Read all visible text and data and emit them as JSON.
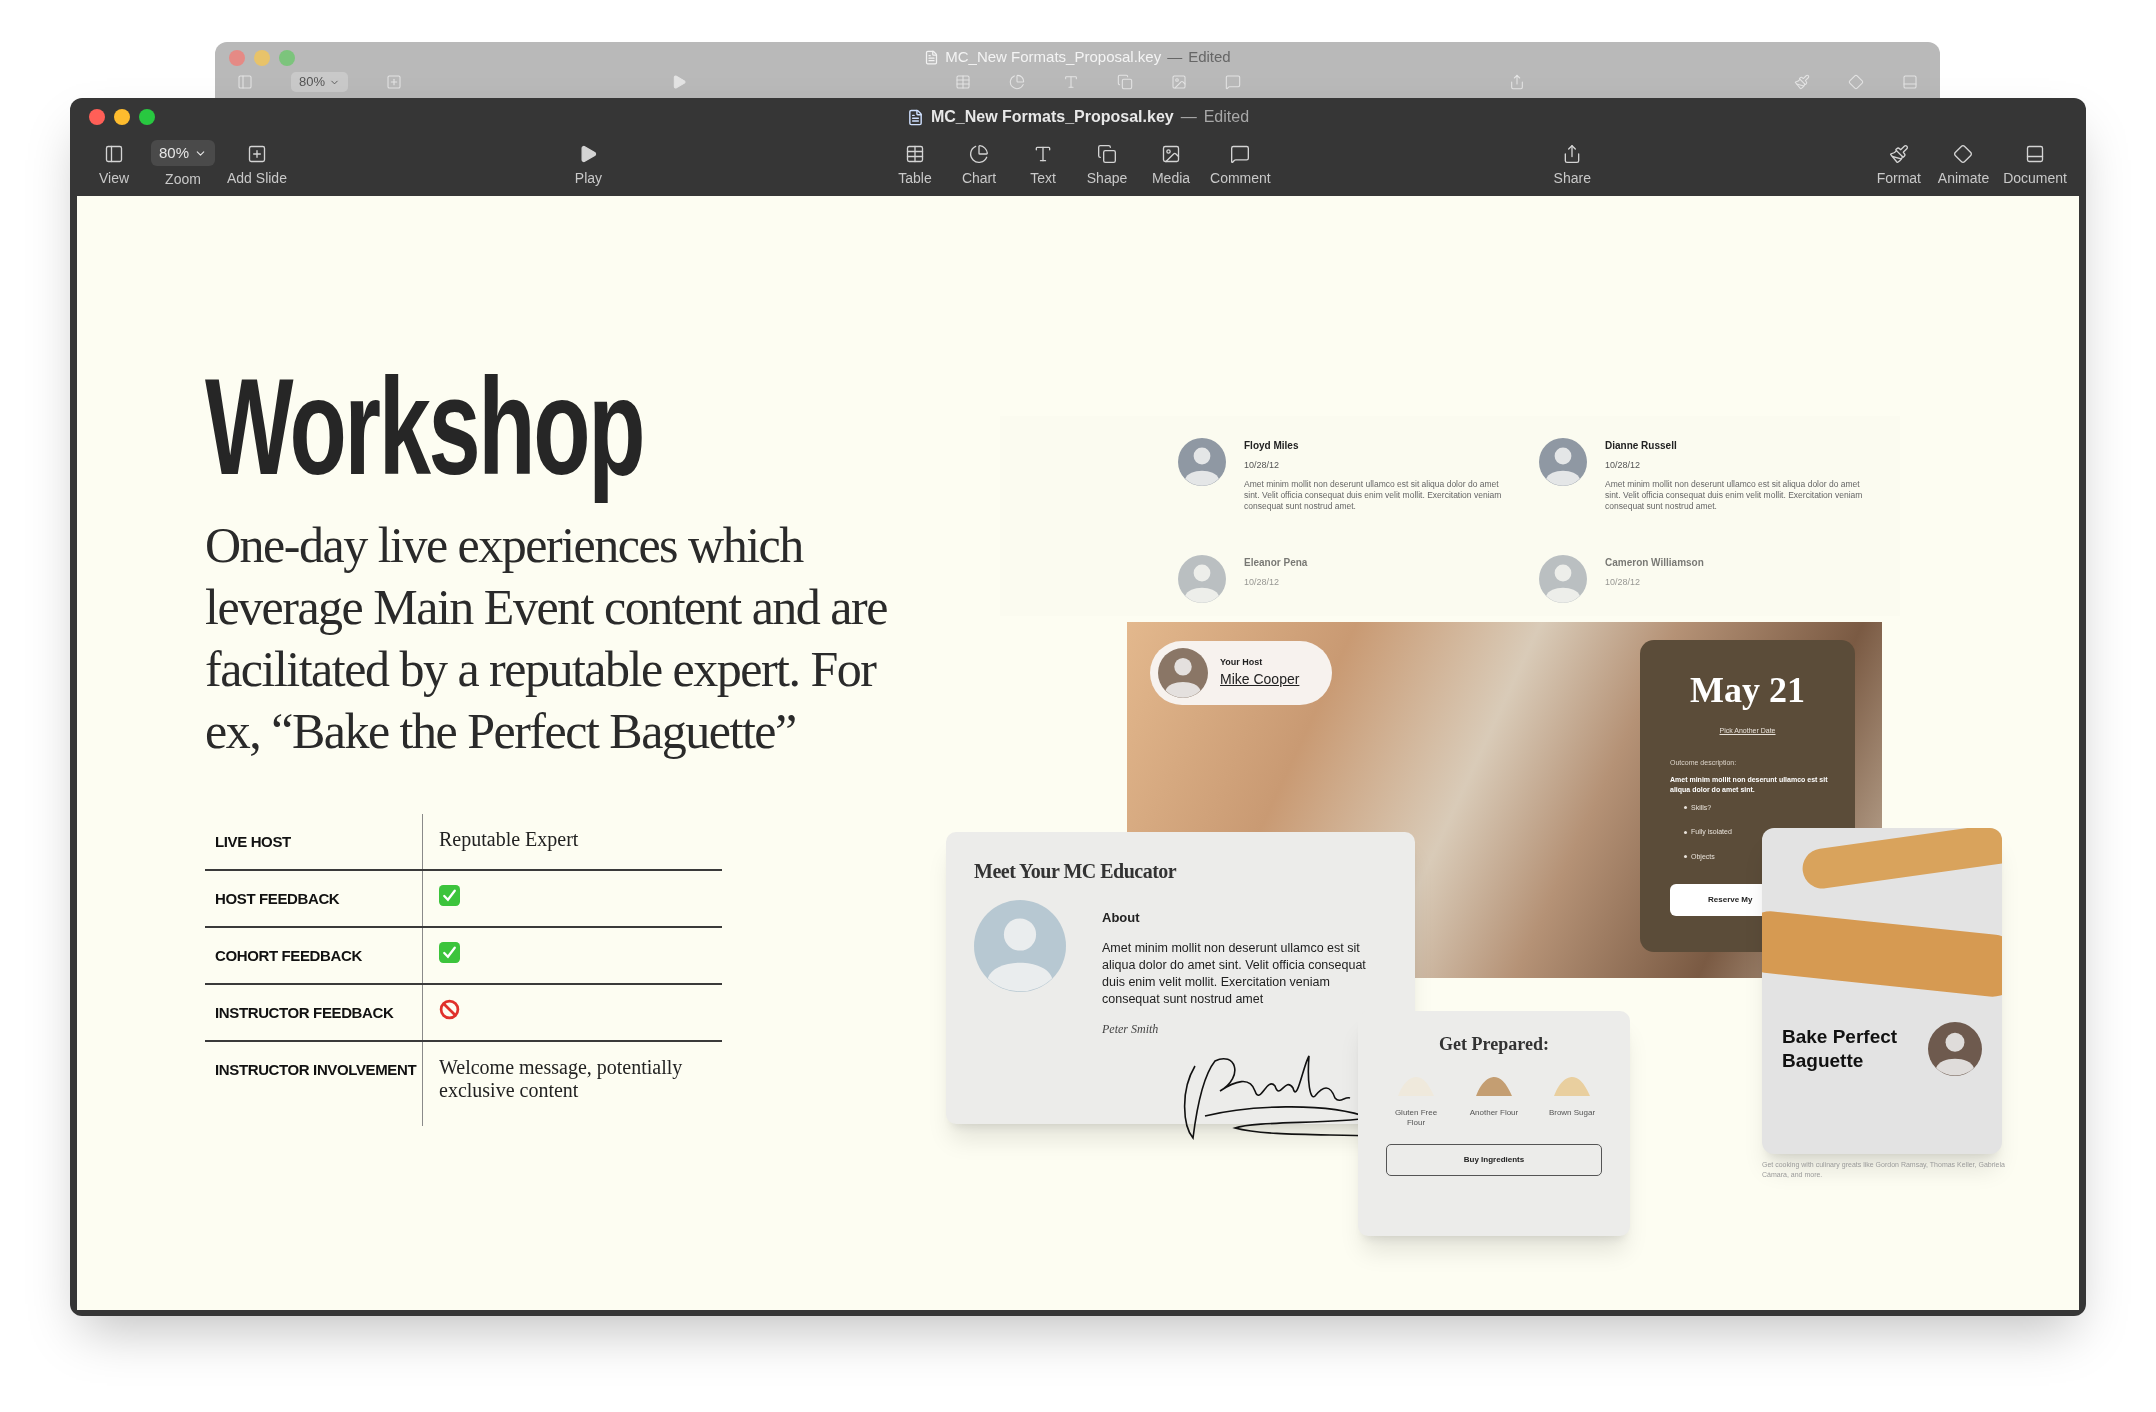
{
  "back_window": {
    "title": "MC_New Formats_Proposal.key",
    "separator": "—",
    "status": "Edited",
    "zoom": "80%"
  },
  "window": {
    "title": "MC_New Formats_Proposal.key",
    "separator": "—",
    "status": "Edited"
  },
  "toolbar": {
    "groups": [
      [
        {
          "label": "View",
          "kind": "view"
        },
        {
          "label": "Zoom",
          "kind": "zoom",
          "value": "80%"
        },
        {
          "label": "Add Slide",
          "kind": "add"
        }
      ],
      [
        {
          "label": "Play",
          "kind": "play"
        }
      ],
      [
        {
          "label": "Table",
          "kind": "table"
        },
        {
          "label": "Chart",
          "kind": "chart"
        },
        {
          "label": "Text",
          "kind": "text"
        },
        {
          "label": "Shape",
          "kind": "shape"
        },
        {
          "label": "Media",
          "kind": "media"
        },
        {
          "label": "Comment",
          "kind": "comment"
        }
      ],
      [
        {
          "label": "Share",
          "kind": "share"
        }
      ],
      [
        {
          "label": "Format",
          "kind": "format"
        },
        {
          "label": "Animate",
          "kind": "animate"
        },
        {
          "label": "Document",
          "kind": "document"
        }
      ]
    ]
  },
  "slide": {
    "title": "Workshop",
    "description": "One-day live experiences which leverage Main Event content and are facilitated by a reputable expert. For ex, “Bake the Perfect Baguette”",
    "table": {
      "rows": [
        {
          "label": "LIVE HOST",
          "kind": "text",
          "value": "Reputable Expert"
        },
        {
          "label": "HOST FEEDBACK",
          "kind": "check"
        },
        {
          "label": "COHORT FEEDBACK",
          "kind": "check"
        },
        {
          "label": "INSTRUCTOR FEEDBACK",
          "kind": "prohibited"
        },
        {
          "label": "INSTRUCTOR INVOLVEMENT",
          "kind": "text",
          "value": "Welcome message, potentially exclusive content"
        }
      ]
    },
    "mockups": {
      "reviews": [
        {
          "name": "Floyd Miles",
          "date": "10/28/12",
          "text": "Amet minim mollit non deserunt ullamco est sit aliqua dolor do amet sint. Velit officia consequat duis enim velit mollit. Exercitation veniam consequat sunt nostrud amet.",
          "faded": false
        },
        {
          "name": "Dianne Russell",
          "date": "10/28/12",
          "text": "Amet minim mollit non deserunt ullamco est sit aliqua dolor do amet sint. Velit officia consequat duis enim velit mollit. Exercitation veniam consequat sunt nostrud amet.",
          "faded": false
        },
        {
          "name": "Eleanor Pena",
          "date": "10/28/12",
          "faded": true
        },
        {
          "name": "Cameron Williamson",
          "date": "10/28/12",
          "faded": true
        }
      ],
      "host": {
        "caption": "Your Host",
        "name": "Mike Cooper"
      },
      "date_card": {
        "date": "May 21",
        "link": "Pick Another Date",
        "label": "Outcome description:",
        "text": "Amet minim mollit non deserunt ullamco est sit aliqua dolor do amet sint.",
        "bullets": [
          "Skills?",
          "Fully isolated",
          "Objects"
        ],
        "button": "Reserve My"
      },
      "educator": {
        "title": "Meet Your MC Educator",
        "heading": "About",
        "text": "Amet minim mollit non deserunt ullamco est sit aliqua dolor do amet sint. Velit officia consequat duis enim velit mollit. Exercitation veniam consequat sunt nostrud amet",
        "name": "Peter Smith"
      },
      "prepare": {
        "title": "Get Prepared:",
        "items": [
          {
            "label": "Gluten Free Flour",
            "color": "#efe9dc"
          },
          {
            "label": "Another Flour",
            "color": "#c49e72"
          },
          {
            "label": "Brown Sugar",
            "color": "#e9cf9f"
          }
        ],
        "button": "Buy Ingredients"
      },
      "course": {
        "title": "Bake Perfect Baguette",
        "caption": "Get cooking with culinary greats like Gordon Ramsay, Thomas Keller, Gabriela Cámara, and more."
      }
    }
  }
}
